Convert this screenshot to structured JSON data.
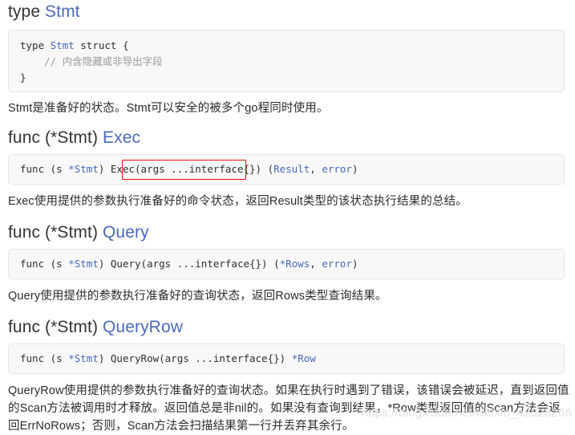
{
  "doc": {
    "title": "type Stmt",
    "watermark": "https://blog.csdn.net/weixin_42528266",
    "accent_link_color": "#4a69bd",
    "annotation_color": "#ee1111",
    "code_bg_color": "#f8f8f8",
    "code_border_color": "#e4e4e4"
  },
  "sections": [
    {
      "id": "type-stmt",
      "heading_prefix": "type ",
      "heading_name": "Stmt",
      "code": {
        "line1_a": "type ",
        "line1_b": "Stmt",
        "line1_c": " struct {",
        "line2": "    // 内含隐藏或非导出字段",
        "line3": "}"
      },
      "description": "Stmt是准备好的状态。Stmt可以安全的被多个go程同时使用。"
    },
    {
      "id": "func-stmt-exec",
      "heading_prefix": "func (*Stmt) ",
      "heading_name": "Exec",
      "code": {
        "a": "func (s ",
        "b": "*Stmt",
        "c": ") Exec(args ...interface{}) (",
        "d": "Result",
        "e": ", ",
        "f": "error",
        "g": ")"
      },
      "annotation": "(args ...interface{})",
      "description": "Exec使用提供的参数执行准备好的命令状态，返回Result类型的该状态执行结果的总结。"
    },
    {
      "id": "func-stmt-query",
      "heading_prefix": "func (*Stmt) ",
      "heading_name": "Query",
      "code": {
        "a": "func (s ",
        "b": "*Stmt",
        "c": ") Query(args ...interface{}) (",
        "d": "*Rows",
        "e": ", ",
        "f": "error",
        "g": ")"
      },
      "description": "Query使用提供的参数执行准备好的查询状态，返回Rows类型查询结果。"
    },
    {
      "id": "func-stmt-queryrow",
      "heading_prefix": "func (*Stmt) ",
      "heading_name": "QueryRow",
      "code": {
        "a": "func (s ",
        "b": "*Stmt",
        "c": ") QueryRow(args ...interface{}) ",
        "d": "*Row",
        "e": "",
        "f": "",
        "g": ""
      },
      "description": "QueryRow使用提供的参数执行准备好的查询状态。如果在执行时遇到了错误，该错误会被延迟，直到返回值的Scan方法被调用时才释放。返回值总是非nil的。如果没有查询到结果，*Row类型返回值的Scan方法会返回ErrNoRows；否则，Scan方法会扫描结果第一行并丢弃其余行。"
    }
  ]
}
